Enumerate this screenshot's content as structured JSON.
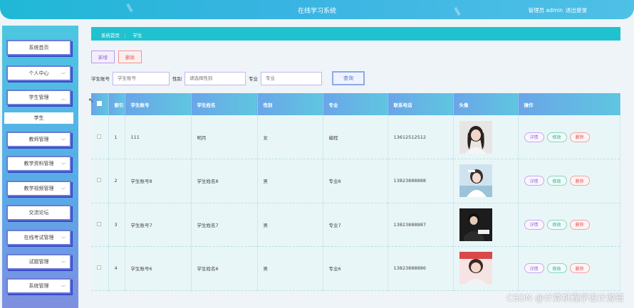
{
  "header": {
    "title": "在线学习系统",
    "user_label": "管理员 admin",
    "logout": "退出登录"
  },
  "sidebar": {
    "items": [
      {
        "label": "系统首页"
      },
      {
        "label": "个人中心"
      },
      {
        "label": "学生管理"
      },
      {
        "label": "教师管理"
      },
      {
        "label": "教学资料管理"
      },
      {
        "label": "教学视频管理"
      },
      {
        "label": "交流论坛"
      },
      {
        "label": "在线考试管理"
      },
      {
        "label": "试题管理"
      },
      {
        "label": "系统管理"
      }
    ],
    "active_sub": "学生"
  },
  "breadcrumb": {
    "home": "系统首页",
    "sep": "：",
    "current": "学生"
  },
  "actions": {
    "add": "新增",
    "delete": "删除"
  },
  "search": {
    "account_label": "学生账号",
    "account_placeholder": "学生账号",
    "gender_label": "性别",
    "gender_placeholder": "请选择性别",
    "major_label": "专业",
    "major_placeholder": "专业",
    "button": "查询"
  },
  "table": {
    "columns": [
      "索引",
      "学生账号",
      "学生姓名",
      "性别",
      "专业",
      "联系电话",
      "头像",
      "操作"
    ],
    "rows": [
      {
        "index": "1",
        "account": "111",
        "name": "明月",
        "gender": "女",
        "major": "编程",
        "phone": "13612512512"
      },
      {
        "index": "2",
        "account": "学生账号8",
        "name": "学生姓名8",
        "gender": "男",
        "major": "专业8",
        "phone": "13823888888"
      },
      {
        "index": "3",
        "account": "学生账号7",
        "name": "学生姓名7",
        "gender": "男",
        "major": "专业7",
        "phone": "13823888887"
      },
      {
        "index": "4",
        "account": "学生账号6",
        "name": "学生姓名6",
        "gender": "男",
        "major": "专业6",
        "phone": "13823888886"
      }
    ],
    "row_actions": {
      "detail": "详情",
      "edit": "修改",
      "delete": "删除"
    }
  },
  "watermark": "CSDN @计算机程序设计源哥",
  "colors": {
    "header": "#1fb8d6",
    "breadcrumb": "#21c2cf",
    "sidebar_border": "#6b7bd8"
  }
}
